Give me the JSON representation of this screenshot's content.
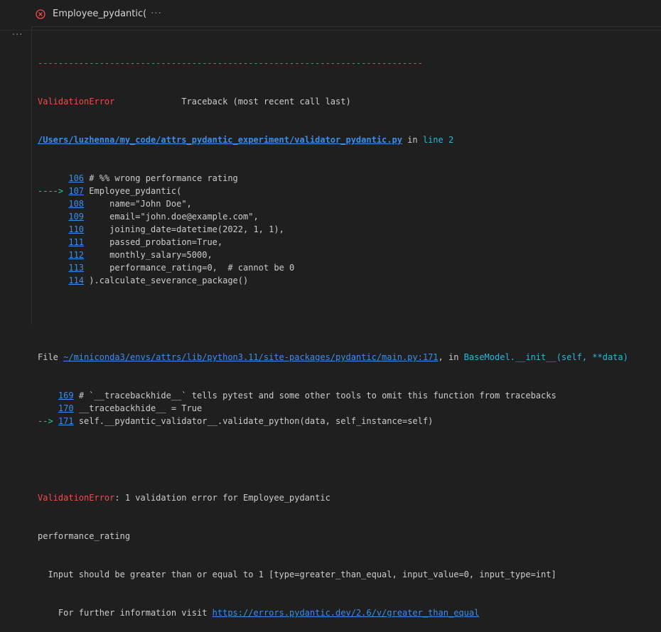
{
  "cell": {
    "title": "Employee_pydantic(",
    "overflow_dots": "···",
    "output_toggle": "···",
    "status": "error",
    "colors": {
      "error": "#f14c4c",
      "link": "#3b8eea",
      "arrow": "#23d18b",
      "cyan": "#29b8db"
    }
  },
  "traceback": {
    "separator": "---------------------------------------------------------------------------",
    "error_name": "ValidationError",
    "header_right": "Traceback (most recent call last)",
    "file_path": "/Users/luzhenna/my_code/attrs_pydantic_experiment/validator_pydantic.py",
    "in_word": " in ",
    "line_ref": "line 2",
    "frame1_lines": [
      {
        "prefix": "      ",
        "num": "106",
        "code": " # %% wrong performance rating"
      },
      {
        "prefix": "----> ",
        "num": "107",
        "code": " Employee_pydantic("
      },
      {
        "prefix": "      ",
        "num": "108",
        "code": "     name=\"John Doe\","
      },
      {
        "prefix": "      ",
        "num": "109",
        "code": "     email=\"john.doe@example.com\","
      },
      {
        "prefix": "      ",
        "num": "110",
        "code": "     joining_date=datetime(2022, 1, 1),"
      },
      {
        "prefix": "      ",
        "num": "111",
        "code": "     passed_probation=True,"
      },
      {
        "prefix": "      ",
        "num": "112",
        "code": "     monthly_salary=5000,"
      },
      {
        "prefix": "      ",
        "num": "113",
        "code": "     performance_rating=0,  # cannot be 0"
      },
      {
        "prefix": "      ",
        "num": "114",
        "code": " ).calculate_severance_package()"
      }
    ],
    "file_word": "File ",
    "frame2_path": "~/miniconda3/envs/attrs/lib/python3.11/site-packages/pydantic/main.py:171",
    "frame2_in": ", in ",
    "frame2_func": "BaseModel.__init__(self, **data)",
    "frame2_lines": [
      {
        "prefix": "    ",
        "num": "169",
        "code": " # `__tracebackhide__` tells pytest and some other tools to omit this function from tracebacks"
      },
      {
        "prefix": "    ",
        "num": "170",
        "code": " __tracebackhide__ = True"
      },
      {
        "prefix": "--> ",
        "num": "171",
        "code": " self.__pydantic_validator__.validate_python(data, self_instance=self)"
      }
    ],
    "final_error_name": "ValidationError",
    "final_error_msg": ": 1 validation error for Employee_pydantic",
    "field_name": "performance_rating",
    "detail": "  Input should be greater than or equal to 1 [type=greater_than_equal, input_value=0, input_type=int]",
    "info_prefix": "    For further information visit ",
    "info_link": "https://errors.pydantic.dev/2.6/v/greater_than_equal"
  }
}
